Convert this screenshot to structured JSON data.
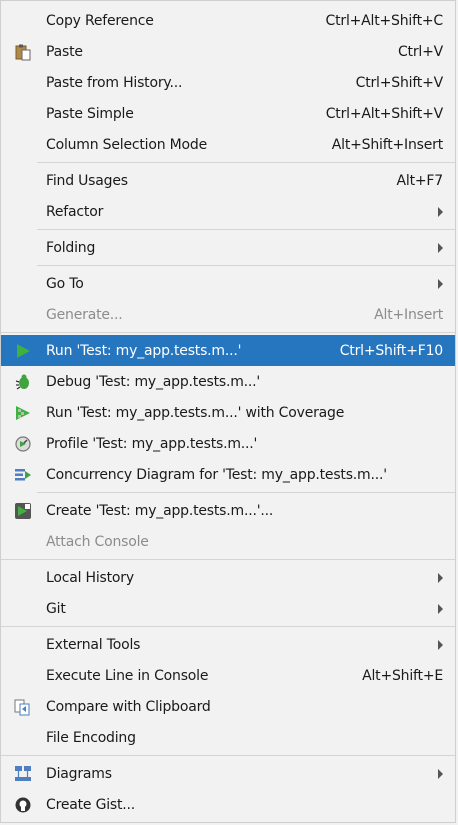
{
  "menu": {
    "items": [
      {
        "label": "Copy Reference",
        "shortcut": "Ctrl+Alt+Shift+C"
      },
      {
        "label": "Paste",
        "shortcut": "Ctrl+V",
        "icon": "paste-icon"
      },
      {
        "label": "Paste from History...",
        "shortcut": "Ctrl+Shift+V"
      },
      {
        "label": "Paste Simple",
        "shortcut": "Ctrl+Alt+Shift+V"
      },
      {
        "label": "Column Selection Mode",
        "shortcut": "Alt+Shift+Insert"
      },
      {
        "label": "Find Usages",
        "shortcut": "Alt+F7"
      },
      {
        "label": "Refactor",
        "submenu": true
      },
      {
        "label": "Folding",
        "submenu": true
      },
      {
        "label": "Go To",
        "submenu": true
      },
      {
        "label": "Generate...",
        "shortcut": "Alt+Insert",
        "disabled": true
      },
      {
        "label": "Run 'Test: my_app.tests.m...'",
        "shortcut": "Ctrl+Shift+F10",
        "icon": "run-icon",
        "selected": true
      },
      {
        "label": "Debug 'Test: my_app.tests.m...'",
        "icon": "debug-icon"
      },
      {
        "label": "Run 'Test: my_app.tests.m...' with Coverage",
        "icon": "coverage-icon"
      },
      {
        "label": "Profile 'Test: my_app.tests.m...'",
        "icon": "profile-icon"
      },
      {
        "label": "Concurrency Diagram for  'Test: my_app.tests.m...'",
        "icon": "concurrency-icon"
      },
      {
        "label": "Create 'Test: my_app.tests.m...'...",
        "icon": "create-config-icon"
      },
      {
        "label": "Attach Console",
        "disabled": true
      },
      {
        "label": "Local History",
        "submenu": true
      },
      {
        "label": "Git",
        "submenu": true
      },
      {
        "label": "External Tools",
        "submenu": true
      },
      {
        "label": "Execute Line in Console",
        "shortcut": "Alt+Shift+E"
      },
      {
        "label": "Compare with Clipboard",
        "icon": "compare-icon"
      },
      {
        "label": "File Encoding"
      },
      {
        "label": "Diagrams",
        "submenu": true,
        "icon": "diagrams-icon"
      },
      {
        "label": "Create Gist...",
        "icon": "gist-icon"
      }
    ]
  },
  "colors": {
    "menu_bg": "#f2f2f2",
    "selected_bg": "#2675bf",
    "disabled_text": "#8c8c8c",
    "separator": "#d5d5d5"
  }
}
